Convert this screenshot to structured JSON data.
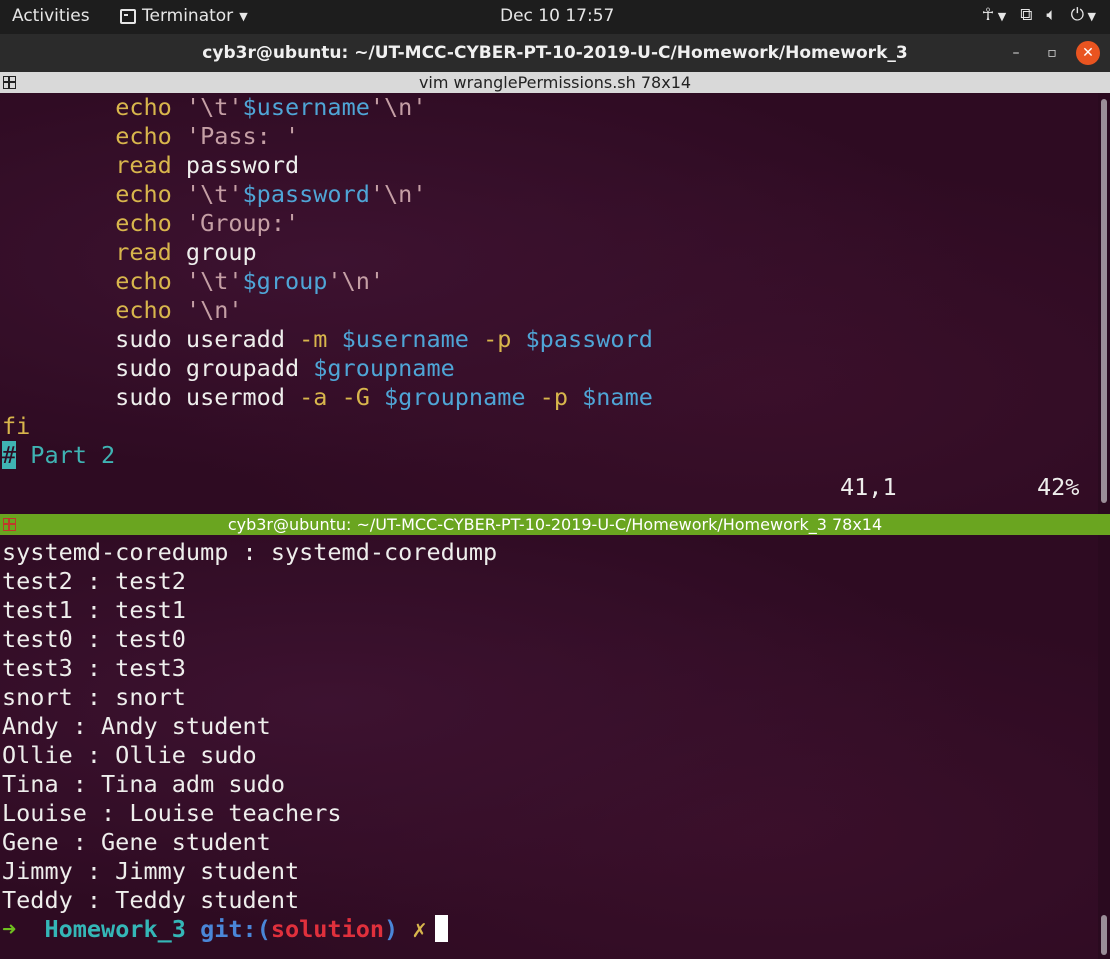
{
  "topbar": {
    "activities": "Activities",
    "app_name": "Terminator",
    "clock": "Dec 10  17:57"
  },
  "window": {
    "title": "cyb3r@ubuntu: ~/UT-MCC-CYBER-PT-10-2019-U-C/Homework/Homework_3"
  },
  "top_pane": {
    "header": "vim wranglePermissions.sh 78x14",
    "status_position": "41,1",
    "status_percent": "42%"
  },
  "bottom_pane": {
    "header": "cyb3r@ubuntu: ~/UT-MCC-CYBER-PT-10-2019-U-C/Homework/Homework_3 78x14",
    "output": [
      "systemd-coredump : systemd-coredump",
      "test2 : test2",
      "test1 : test1",
      "test0 : test0",
      "test3 : test3",
      "snort : snort",
      "Andy : Andy student",
      "Ollie : Ollie sudo",
      "Tina : Tina adm sudo",
      "Louise : Louise teachers",
      "Gene : Gene student",
      "Jimmy : Jimmy student",
      "Teddy : Teddy student"
    ],
    "prompt": {
      "arrow": "➜",
      "dir": "Homework_3",
      "git": "git:",
      "branch_open": "(",
      "branch": "solution",
      "branch_close": ")",
      "dirty": "✗"
    }
  },
  "icons": {
    "accessibility": "accessibility-icon",
    "network": "network-icon",
    "volume": "volume-icon",
    "power": "power-icon"
  }
}
